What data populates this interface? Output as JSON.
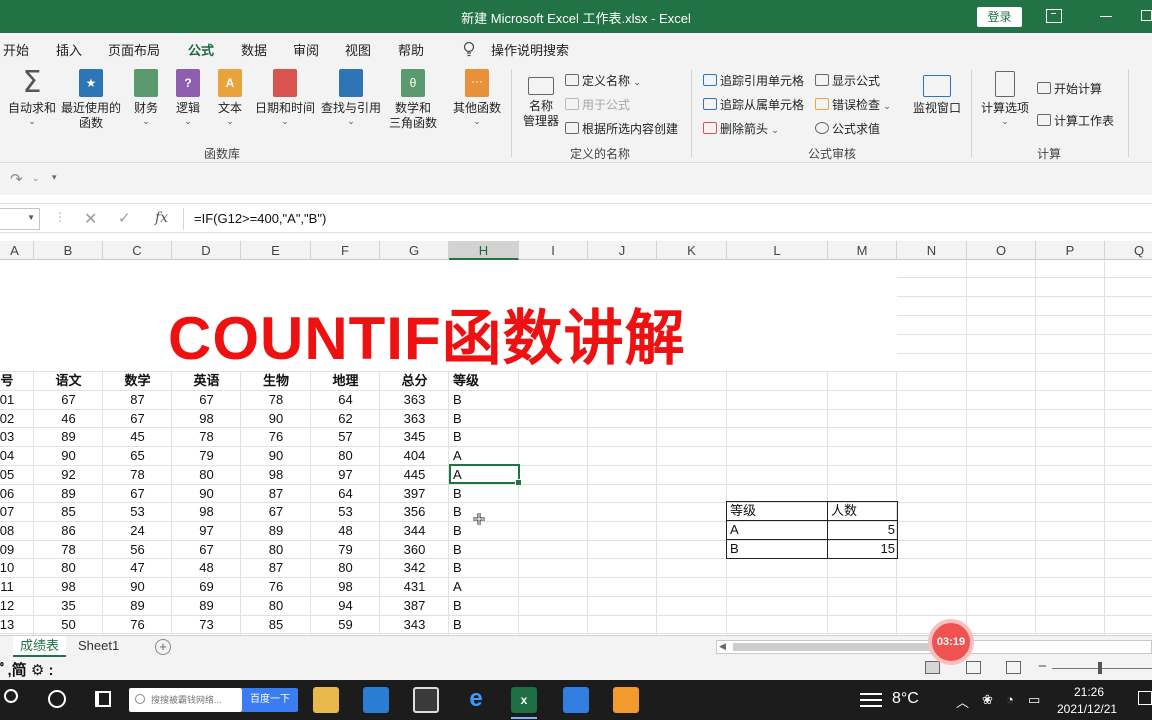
{
  "window": {
    "title": "新建 Microsoft Excel 工作表.xlsx  -  Excel",
    "login_label": "登录"
  },
  "tabs": [
    "开始",
    "插入",
    "页面布局",
    "公式",
    "数据",
    "审阅",
    "视图",
    "帮助"
  ],
  "active_tab": "公式",
  "tell_me": "操作说明搜索",
  "ribbon": {
    "function_library": {
      "label": "函数库",
      "buttons": [
        {
          "label": "自动求和",
          "icon": "sigma-icon",
          "color": "#555555"
        },
        {
          "label": "最近使用的",
          "label2": "函数",
          "icon": "star-book-icon",
          "color": "#2e75b6"
        },
        {
          "label": "财务",
          "icon": "finance-book-icon",
          "color": "#5a9a6e"
        },
        {
          "label": "逻辑",
          "icon": "logic-book-icon",
          "color": "#8e5fb0"
        },
        {
          "label": "文本",
          "icon": "text-book-icon",
          "color": "#e8a33a"
        },
        {
          "label": "日期和时间",
          "icon": "date-book-icon",
          "color": "#d9534f"
        },
        {
          "label": "查找与引用",
          "icon": "lookup-book-icon",
          "color": "#2e75b6"
        },
        {
          "label": "数学和",
          "label2": "三角函数",
          "icon": "math-book-icon",
          "color": "#5a9a6e"
        },
        {
          "label": "其他函数",
          "icon": "more-book-icon",
          "color": "#e8913a"
        }
      ]
    },
    "defined_names": {
      "label": "定义的名称",
      "manager_label": "名称",
      "manager_label2": "管理器",
      "define_name": "定义名称",
      "use_in_formula": "用于公式",
      "create_from_selection": "根据所选内容创建"
    },
    "formula_auditing": {
      "label": "公式审核",
      "trace_precedents": "追踪引用单元格",
      "trace_dependents": "追踪从属单元格",
      "remove_arrows": "删除箭头",
      "show_formulas": "显示公式",
      "error_checking": "错误检查",
      "evaluate_formula": "公式求值",
      "watch_window": "监视窗口"
    },
    "calculation": {
      "label": "计算",
      "options": "计算选项",
      "calc_now": "开始计算",
      "calc_sheet": "计算工作表"
    }
  },
  "formula_bar": {
    "formula": "=IF(G12>=400,\"A\",\"B\")"
  },
  "columns": [
    "A",
    "B",
    "C",
    "D",
    "E",
    "F",
    "G",
    "H",
    "I",
    "J",
    "K",
    "L",
    "M",
    "N",
    "O",
    "P",
    "Q"
  ],
  "selected_column": "H",
  "sheet": {
    "title": "COUNTIF函数讲解",
    "headers": [
      "号",
      "语文",
      "数学",
      "英语",
      "生物",
      "地理",
      "总分",
      "等级"
    ],
    "rows": [
      [
        "01",
        "67",
        "87",
        "67",
        "78",
        "64",
        "363",
        "B"
      ],
      [
        "02",
        "46",
        "67",
        "98",
        "90",
        "62",
        "363",
        "B"
      ],
      [
        "03",
        "89",
        "45",
        "78",
        "76",
        "57",
        "345",
        "B"
      ],
      [
        "04",
        "90",
        "65",
        "79",
        "90",
        "80",
        "404",
        "A"
      ],
      [
        "05",
        "92",
        "78",
        "80",
        "98",
        "97",
        "445",
        "A"
      ],
      [
        "06",
        "89",
        "67",
        "90",
        "87",
        "64",
        "397",
        "B"
      ],
      [
        "07",
        "85",
        "53",
        "98",
        "67",
        "53",
        "356",
        "B"
      ],
      [
        "08",
        "86",
        "24",
        "97",
        "89",
        "48",
        "344",
        "B"
      ],
      [
        "09",
        "78",
        "56",
        "67",
        "80",
        "79",
        "360",
        "B"
      ],
      [
        "10",
        "80",
        "47",
        "48",
        "87",
        "80",
        "342",
        "B"
      ],
      [
        "11",
        "98",
        "90",
        "69",
        "76",
        "98",
        "431",
        "A"
      ],
      [
        "12",
        "35",
        "89",
        "89",
        "80",
        "94",
        "387",
        "B"
      ],
      [
        "13",
        "50",
        "76",
        "73",
        "85",
        "59",
        "343",
        "B"
      ]
    ],
    "summary": {
      "header": [
        "等级",
        "人数"
      ],
      "rows": [
        [
          "A",
          "5"
        ],
        [
          "B",
          "15"
        ]
      ]
    }
  },
  "sheet_tabs": [
    {
      "label": "成绩表",
      "active": true
    },
    {
      "label": "Sheet1",
      "active": false
    }
  ],
  "status": {
    "ime_text": "ﾟ,简"
  },
  "recording": "03:19",
  "taskbar": {
    "search_placeholder": "搜搜被霸钱网络...",
    "baidu_button": "百度一下",
    "temperature": "8°C",
    "time": "21:26",
    "date": "2021/12/21"
  }
}
